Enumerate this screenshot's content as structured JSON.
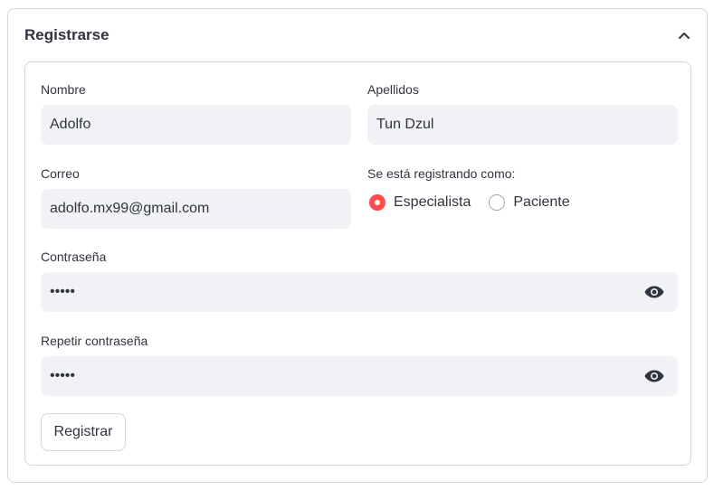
{
  "expander": {
    "title": "Registrarse",
    "icon": "chevron-up-icon"
  },
  "form": {
    "nombre": {
      "label": "Nombre",
      "value": "Adolfo"
    },
    "apellidos": {
      "label": "Apellidos",
      "value": "Tun Dzul"
    },
    "correo": {
      "label": "Correo",
      "value": "adolfo.mx99@gmail.com"
    },
    "rol": {
      "label": "Se está registrando como:",
      "options": [
        {
          "label": "Especialista",
          "selected": true
        },
        {
          "label": "Paciente",
          "selected": false
        }
      ]
    },
    "contrasena": {
      "label": "Contraseña",
      "value": "•••••",
      "icon": "eye-icon"
    },
    "repetir": {
      "label": "Repetir contraseña",
      "value": "•••••",
      "icon": "eye-icon"
    },
    "submit_label": "Registrar"
  },
  "colors": {
    "accent": "#ff4b4b",
    "field_bg": "#f0f2f6",
    "border": "#d6d6d9",
    "text": "#31333f"
  }
}
